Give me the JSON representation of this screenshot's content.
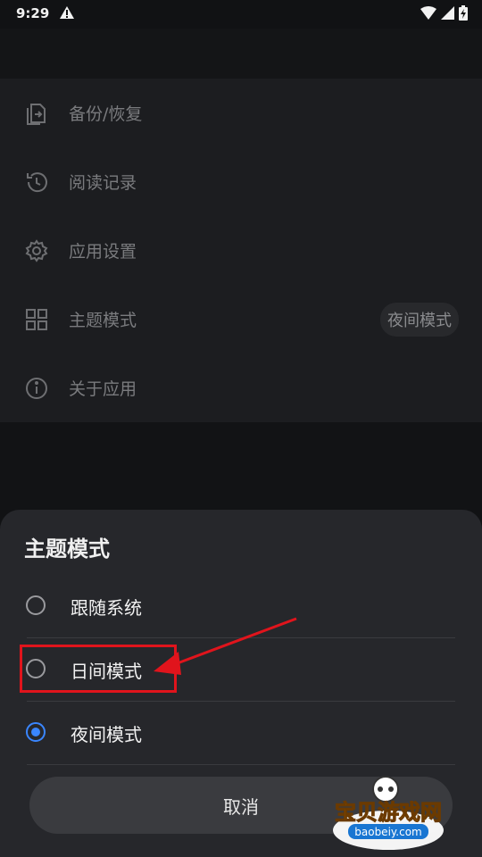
{
  "status_bar": {
    "time": "9:29"
  },
  "menu": {
    "items": [
      {
        "label": "备份/恢复",
        "icon": "backup-restore-icon"
      },
      {
        "label": "阅读记录",
        "icon": "history-icon"
      },
      {
        "label": "应用设置",
        "icon": "gear-icon"
      },
      {
        "label": "主题模式",
        "icon": "grid-icon",
        "value": "夜间模式"
      },
      {
        "label": "关于应用",
        "icon": "info-icon"
      }
    ]
  },
  "sheet": {
    "title": "主题模式",
    "options": [
      {
        "label": "跟随系统",
        "checked": false
      },
      {
        "label": "日间模式",
        "checked": false
      },
      {
        "label": "夜间模式",
        "checked": true
      }
    ],
    "cancel_label": "取消"
  },
  "watermark": {
    "brand": "宝贝游戏网",
    "url": "baobeiy.com"
  },
  "colors": {
    "accent": "#3a86ff",
    "annotation": "#e0141c"
  }
}
